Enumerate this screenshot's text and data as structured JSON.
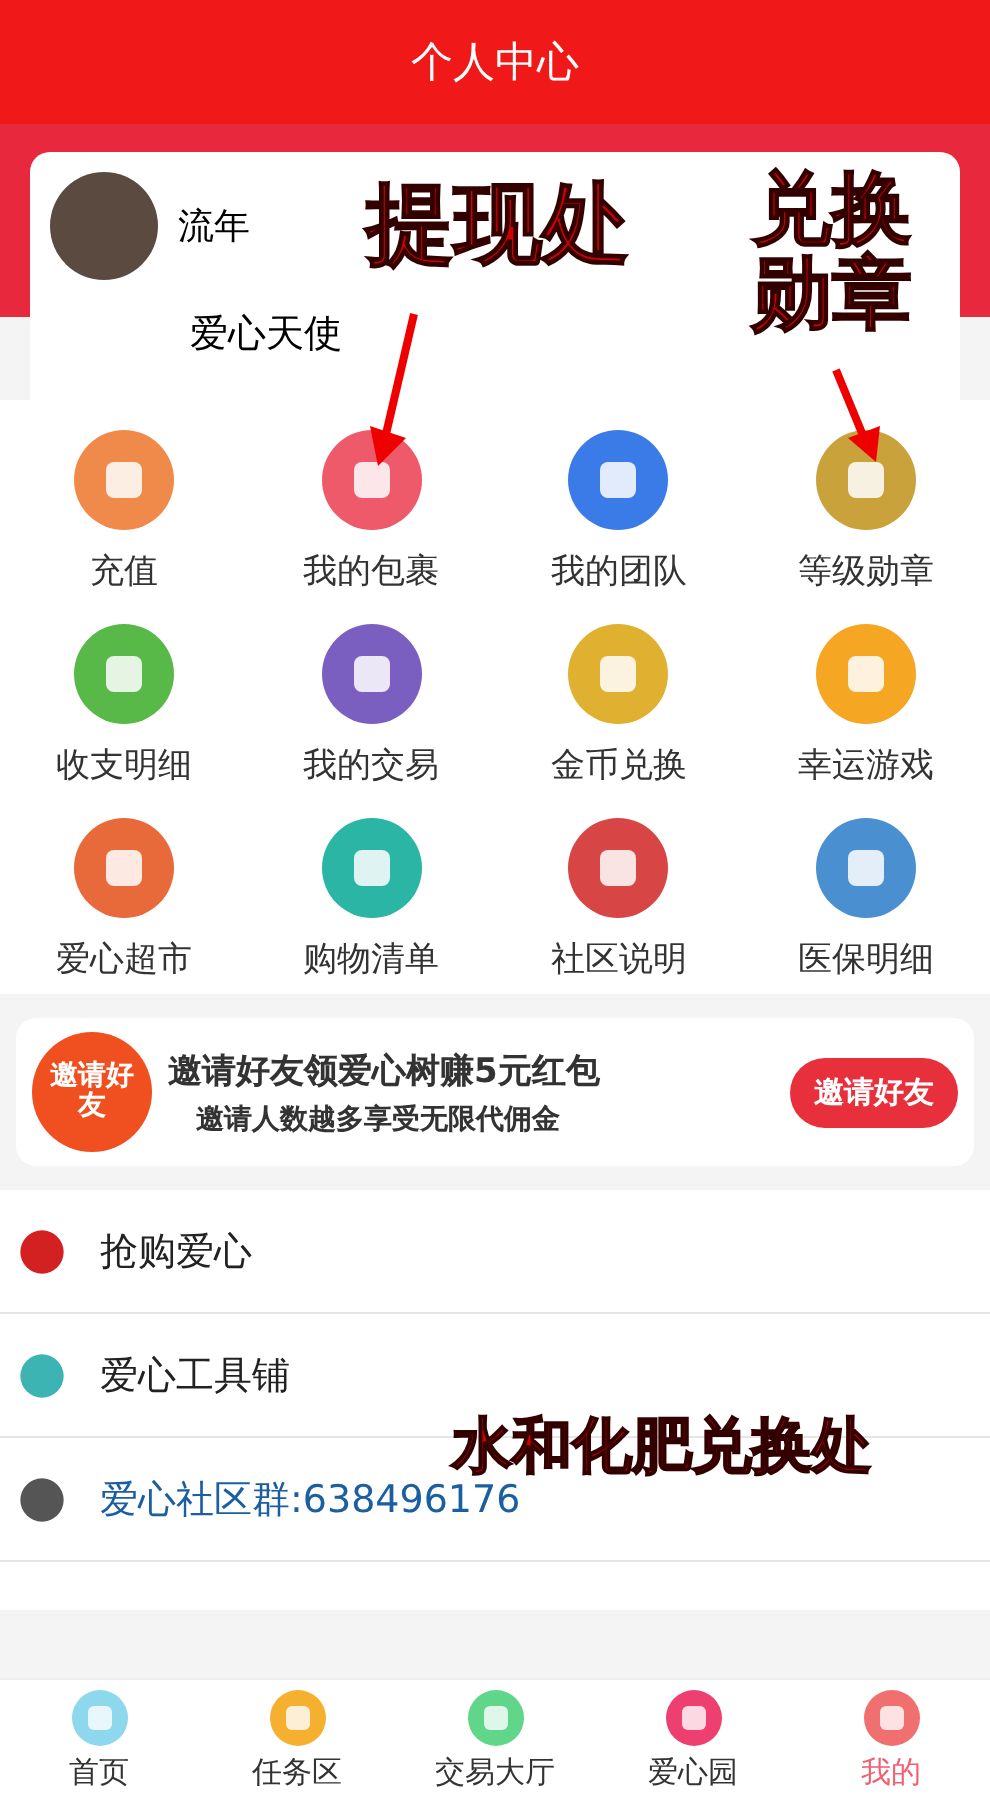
{
  "header": {
    "title": "个人中心"
  },
  "profile": {
    "name": "流年",
    "level_title": "爱心天使"
  },
  "grid": [
    {
      "label": "充值"
    },
    {
      "label": "我的包裹"
    },
    {
      "label": "我的团队"
    },
    {
      "label": "等级勋章"
    },
    {
      "label": "收支明细"
    },
    {
      "label": "我的交易"
    },
    {
      "label": "金币兑换"
    },
    {
      "label": "幸运游戏"
    },
    {
      "label": "爱心超市"
    },
    {
      "label": "购物清单"
    },
    {
      "label": "社区说明"
    },
    {
      "label": "医保明细"
    }
  ],
  "banner": {
    "badge": "邀请好友",
    "headline": "邀请好友领爱心树赚5元红包",
    "subline": "邀请人数越多享受无限代佣金",
    "button": "邀请好友"
  },
  "menu": [
    {
      "label": "抢购爱心",
      "kind": "plain"
    },
    {
      "label": "爱心工具铺",
      "kind": "plain"
    },
    {
      "label": "爱心社区群:638496176",
      "kind": "link"
    }
  ],
  "tabbar": [
    {
      "label": "首页",
      "selected": false
    },
    {
      "label": "任务区",
      "selected": false
    },
    {
      "label": "交易大厅",
      "selected": false
    },
    {
      "label": "爱心园",
      "selected": false
    },
    {
      "label": "我的",
      "selected": true
    }
  ],
  "annotations": [
    {
      "text": "提现处"
    },
    {
      "text": "兑换勋章"
    },
    {
      "text": "水和化肥兑换处"
    }
  ]
}
